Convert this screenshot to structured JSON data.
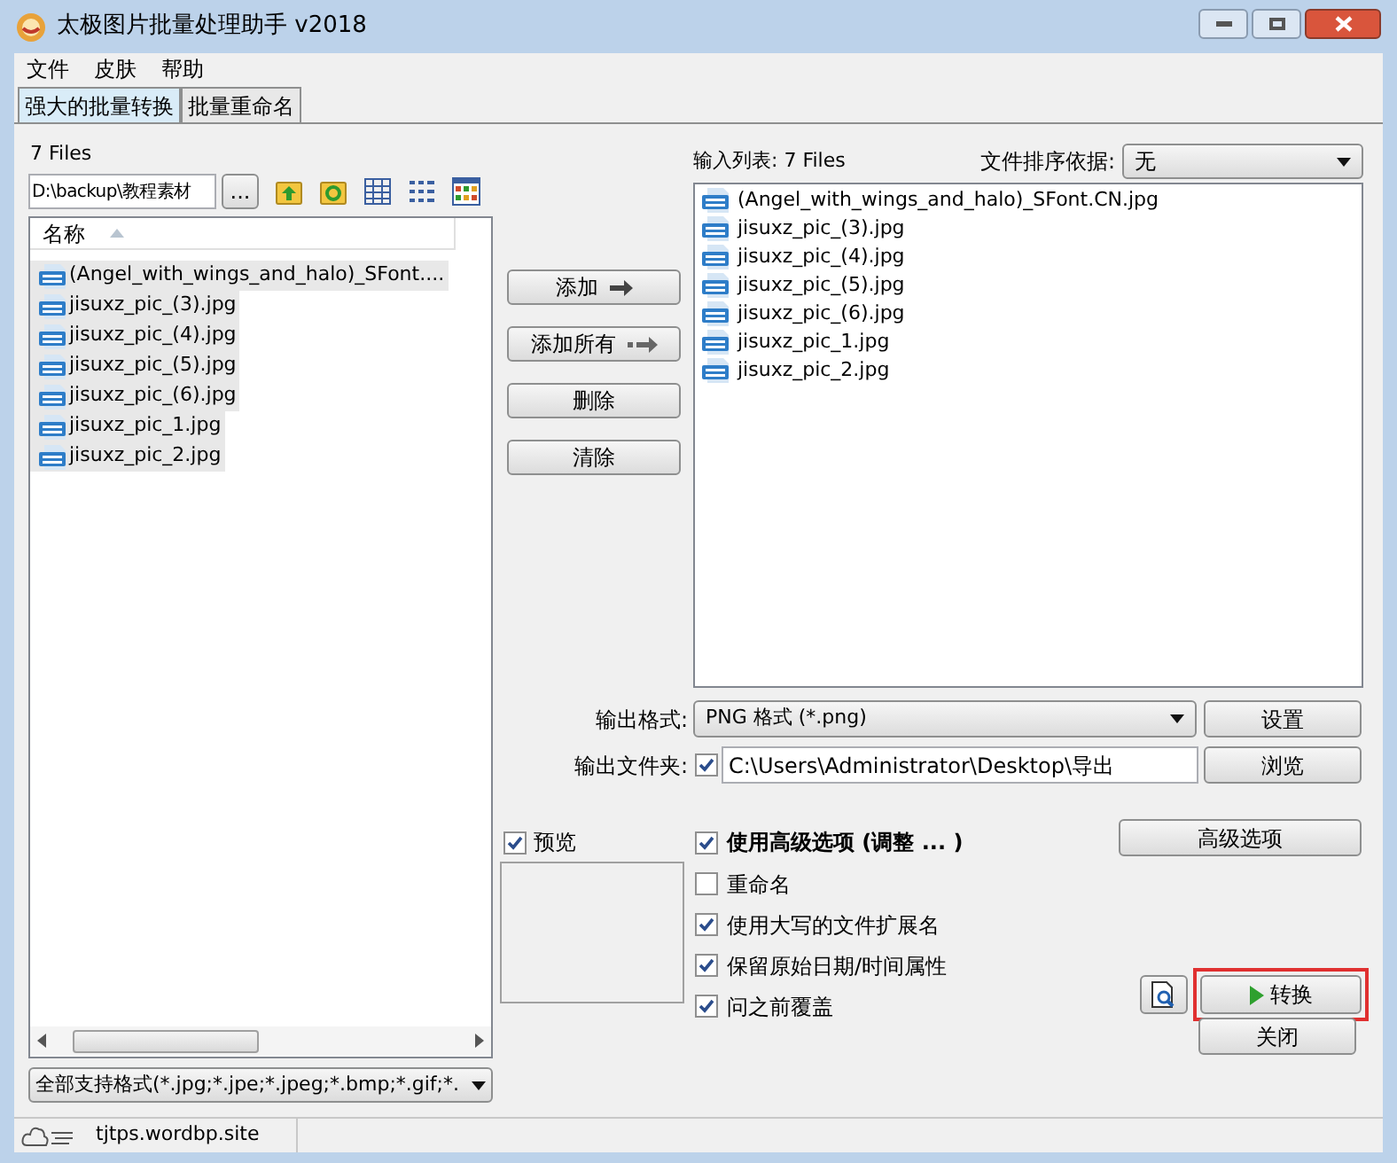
{
  "window": {
    "title": "太极图片批量处理助手  v2018"
  },
  "menu": [
    "文件",
    "皮肤",
    "帮助"
  ],
  "tabs": [
    {
      "label": "强大的批量转换",
      "selected": true
    },
    {
      "label": "批量重命名",
      "selected": false
    }
  ],
  "source": {
    "count": "7 Files",
    "path": "D:\\backup\\教程素材",
    "browse_button": "...",
    "column": "名称",
    "files": [
      {
        "name": "(Angel_with_wings_and_halo)_SFont....",
        "selected": true
      },
      {
        "name": "jisuxz_pic_(3).jpg",
        "selected": true
      },
      {
        "name": "jisuxz_pic_(4).jpg",
        "selected": true
      },
      {
        "name": "jisuxz_pic_(5).jpg",
        "selected": true
      },
      {
        "name": "jisuxz_pic_(6).jpg",
        "selected": true
      },
      {
        "name": "jisuxz_pic_1.jpg",
        "selected": true
      },
      {
        "name": "jisuxz_pic_2.jpg",
        "selected": true
      }
    ],
    "filter": "全部支持格式(*.jpg;*.jpe;*.jpeg;*.bmp;*.gif;*."
  },
  "actions": [
    {
      "label": "添加",
      "kind": "arrow"
    },
    {
      "label": "添加所有",
      "kind": "double-arrow"
    },
    {
      "label": "删除",
      "kind": "plain"
    },
    {
      "label": "清除",
      "kind": "plain"
    }
  ],
  "input_list": {
    "label": "输入列表:",
    "count": "7 Files",
    "sort_label": "文件排序依据:",
    "sort_value": "无",
    "files": [
      "(Angel_with_wings_and_halo)_SFont.CN.jpg",
      "jisuxz_pic_(3).jpg",
      "jisuxz_pic_(4).jpg",
      "jisuxz_pic_(5).jpg",
      "jisuxz_pic_(6).jpg",
      "jisuxz_pic_1.jpg",
      "jisuxz_pic_2.jpg"
    ]
  },
  "output_format": {
    "label": "输出格式:",
    "value": "PNG 格式  (*.png)",
    "button": "设置"
  },
  "output_folder": {
    "label": "输出文件夹:",
    "checked": true,
    "value": "C:\\Users\\Administrator\\Desktop\\导出",
    "button": "浏览"
  },
  "preview": {
    "label": "预览",
    "checked": true
  },
  "options": [
    {
      "label": "使用高级选项  (调整 ... )",
      "checked": true,
      "bold": true
    },
    {
      "label": "重命名",
      "checked": false,
      "bold": false
    },
    {
      "label": "使用大写的文件扩展名",
      "checked": true,
      "bold": false
    },
    {
      "label": "保留原始日期/时间属性",
      "checked": true,
      "bold": false
    },
    {
      "label": "问之前覆盖",
      "checked": true,
      "bold": false
    }
  ],
  "advanced_button": "高级选项",
  "convert_button": {
    "label": "转换",
    "highlighted": true
  },
  "close_button": "关闭",
  "status_bar": {
    "text": "tjtps.wordbp.site"
  }
}
